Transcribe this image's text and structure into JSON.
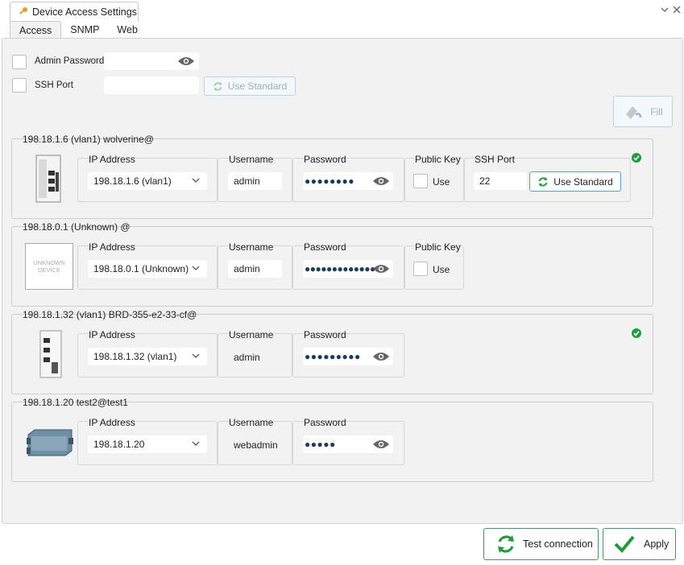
{
  "window": {
    "title": "Device Access Settings"
  },
  "tabs": [
    {
      "label": "Access"
    },
    {
      "label": "SNMP"
    },
    {
      "label": "Web"
    }
  ],
  "global": {
    "admin_password_label": "Admin Password",
    "ssh_port_label": "SSH Port",
    "use_standard_label": "Use Standard",
    "fill_label": "Fill"
  },
  "labels": {
    "ip_address": "IP Address",
    "username": "Username",
    "password": "Password",
    "public_key": "Public Key",
    "ssh_port": "SSH Port",
    "use": "Use",
    "use_standard": "Use Standard",
    "unknown_device": "UNKNOWN DEVICE"
  },
  "devices": [
    {
      "title": "198.18.1.6 (vlan1) wolverine@",
      "ip": "198.18.1.6 (vlan1)",
      "username": "admin",
      "password": "●●●●●●●●",
      "ssh_port": "22",
      "status": "ok"
    },
    {
      "title": "198.18.0.1 (Unknown) @",
      "ip": "198.18.0.1 (Unknown)",
      "username": "admin",
      "password": "●●●●●●●●●●●●●"
    },
    {
      "title": "198.18.1.32 (vlan1) BRD-355-e2-33-cf@",
      "ip": "198.18.1.32 (vlan1)",
      "username": "admin",
      "password": "●●●●●●●●●",
      "status": "ok"
    },
    {
      "title": "198.18.1.20 test2@test1",
      "ip": "198.18.1.20",
      "username": "webadmin",
      "password": "●●●●●"
    }
  ],
  "footer": {
    "test_connection_label": "Test connection",
    "apply_label": "Apply"
  },
  "colors": {
    "accent": "#3a8ec0",
    "ok": "#1c9e3e",
    "key_icon": "#e0a030"
  }
}
